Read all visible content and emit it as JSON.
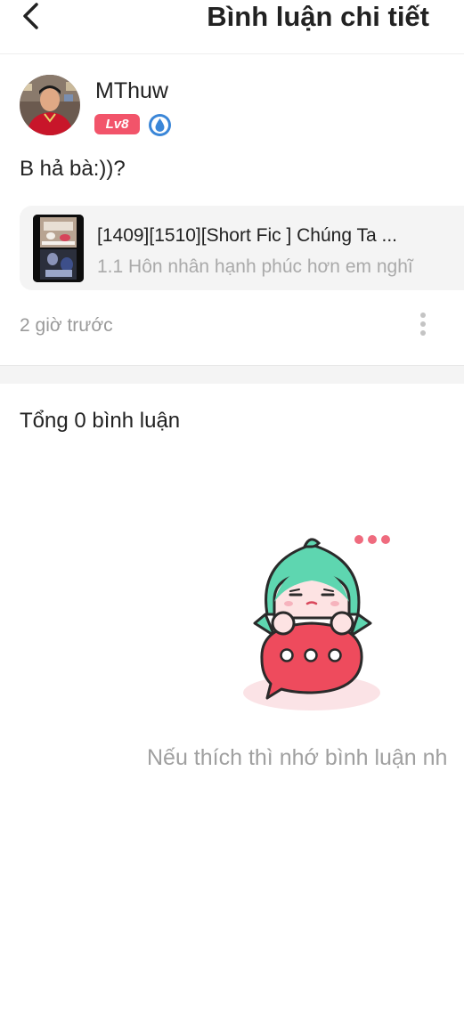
{
  "header": {
    "title": "Bình luận chi tiết",
    "back_icon": "chevron-left-icon"
  },
  "comment": {
    "username": "MThuw",
    "level_badge": "Lv8",
    "badge_color": "#f2546a",
    "medal_icon": "water-drop-medal-icon",
    "text": "B hả bà:))?",
    "time": "2 giờ trước"
  },
  "book": {
    "title": "[1409][1510][Short Fic ] Chúng Ta ...",
    "chapter": "1.1 Hôn nhân hạnh phúc hơn em nghĩ"
  },
  "comments_section": {
    "total_label": "Tổng 0 bình luận",
    "empty_message": "Nếu thích thì nhớ bình luận nh"
  },
  "colors": {
    "accent": "#f2546a",
    "muted_text": "#9a9a9a",
    "card_bg": "#f4f4f4"
  }
}
